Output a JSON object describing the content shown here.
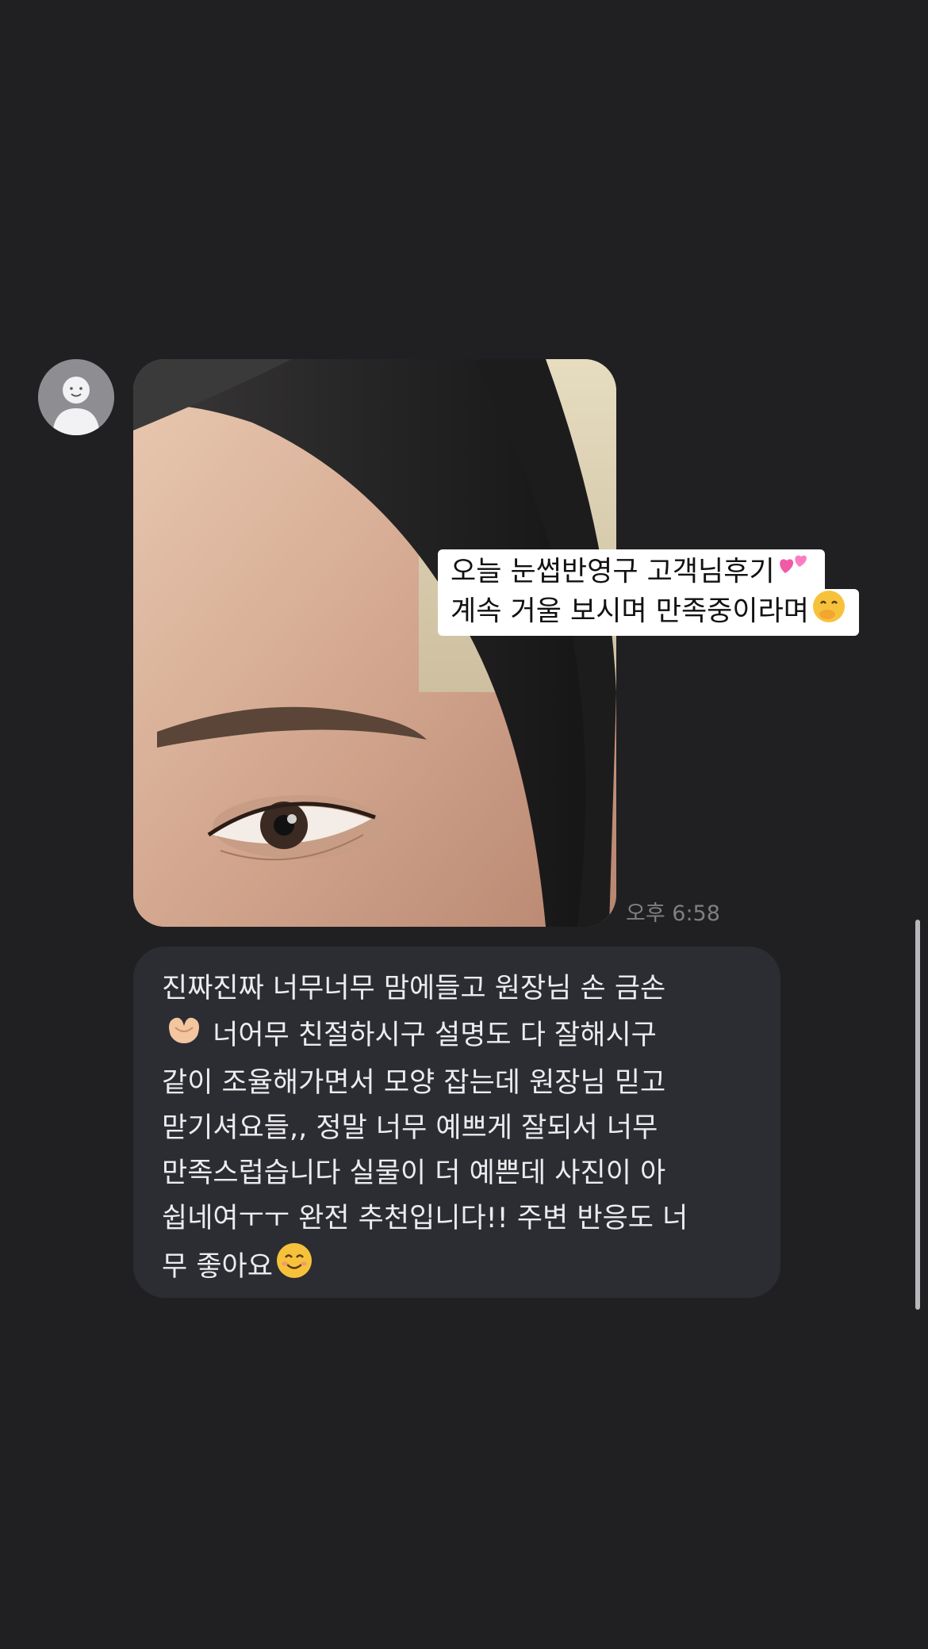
{
  "chat": {
    "sender_avatar": "person-silhouette-icon",
    "photo_caption_line1": "오늘 눈썹반영구 고객님후기",
    "photo_caption_line1_emoji": "two-hearts-icon",
    "photo_caption_line2": "계속 거울 보시며 만족중이라며",
    "photo_caption_line2_emoji": "face-with-hand-over-mouth-icon",
    "photo_time": "오후 6:58",
    "review_lines": [
      "진짜진짜 너무너무 맘에들고 원장님 손 금손",
      "너어무 친절하시구 설명도 다 잘해시구",
      "같이 조율해가면서 모양 잡는데 원장님 믿고",
      "맏기셔요들,, 정말 너무 예쁘게 잘되서 너무",
      "만족스럽습니다 실물이 더 예쁜데 사진이 아",
      "쉽네여ㅜㅜ 완전 추천입니다!! 주변 반응도 너",
      "무 좋아요"
    ],
    "review_emojis": [
      "heart-hands-icon",
      "smiling-face-icon"
    ]
  },
  "colors": {
    "background": "#202022",
    "bubble": "#2c2d33",
    "caption_bg": "#ffffff",
    "time_text": "#7e7e84"
  }
}
